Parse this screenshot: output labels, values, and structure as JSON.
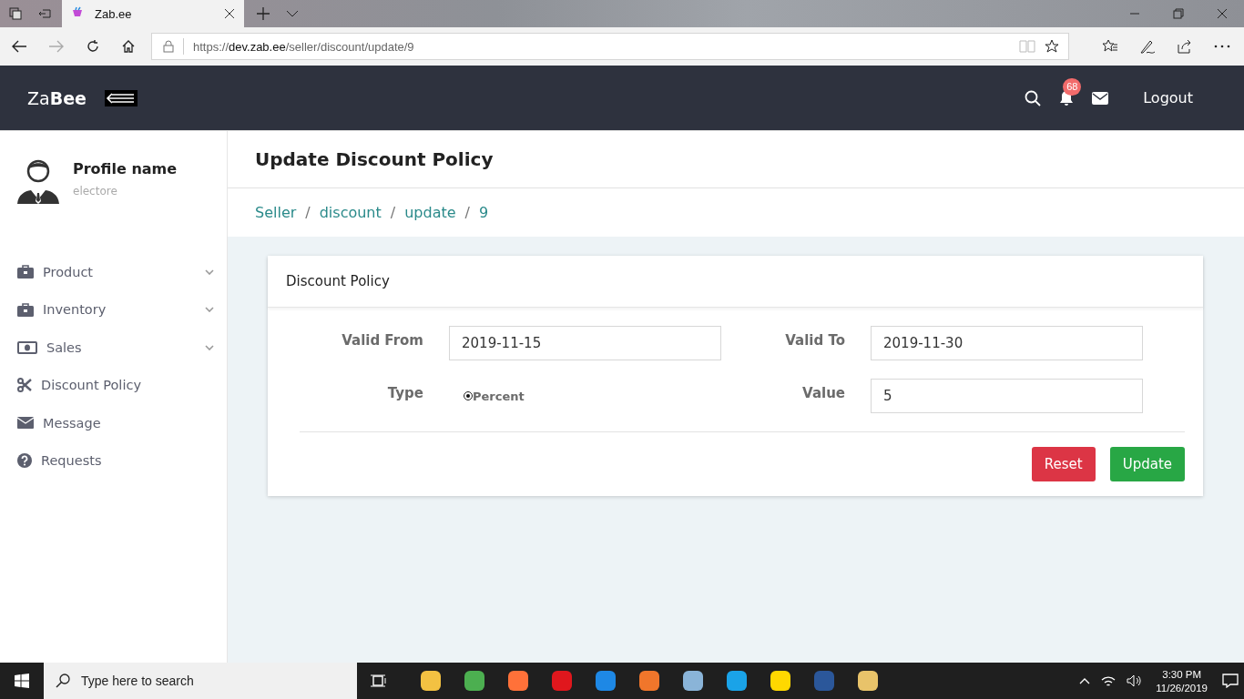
{
  "browser": {
    "tab_title": "Zab.ee",
    "url_host": "dev.zab.ee",
    "url_prefix": "https://",
    "url_path": "/seller/discount/update/9"
  },
  "header": {
    "logo_light": "Za",
    "logo_bold": "Bee",
    "notification_count": "68",
    "logout": "Logout"
  },
  "profile": {
    "name": "Profile name",
    "username": "electore"
  },
  "sidebar": {
    "items": [
      {
        "label": "Product",
        "has_submenu": true
      },
      {
        "label": "Inventory",
        "has_submenu": true
      },
      {
        "label": "Sales",
        "has_submenu": true
      },
      {
        "label": "Discount Policy",
        "has_submenu": false
      },
      {
        "label": "Message",
        "has_submenu": false
      },
      {
        "label": "Requests",
        "has_submenu": false
      }
    ]
  },
  "page": {
    "title": "Update Discount Policy",
    "breadcrumb": [
      {
        "label": "Seller"
      },
      {
        "separator": "/",
        "label": "discount"
      },
      {
        "separator": "/",
        "label": "update"
      },
      {
        "separator": "/",
        "label": "9"
      }
    ]
  },
  "card": {
    "title": "Discount Policy",
    "valid_from": {
      "label": "Valid From",
      "value": "2019-11-15"
    },
    "valid_to": {
      "label": "Valid To",
      "value": "2019-11-30"
    },
    "type": {
      "label": "Type",
      "options": [
        {
          "label": "Percent",
          "selected": true
        }
      ]
    },
    "value": {
      "label": "Value",
      "value": "5"
    },
    "buttons": {
      "reset": "Reset",
      "update": "Update"
    }
  },
  "taskbar": {
    "search_placeholder": "Type here to search",
    "time": "3:30 PM",
    "date": "11/26/2019"
  }
}
